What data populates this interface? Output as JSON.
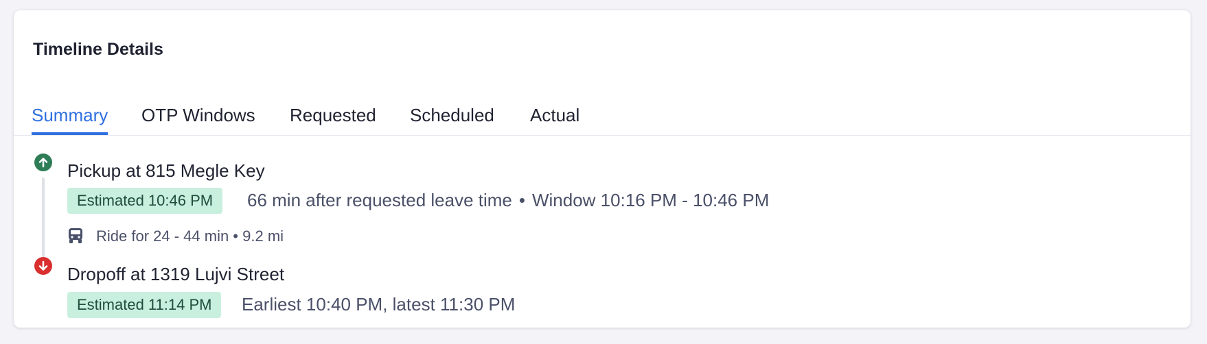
{
  "card": {
    "title": "Timeline Details"
  },
  "tabs": [
    {
      "label": "Summary",
      "active": true
    },
    {
      "label": "OTP Windows",
      "active": false
    },
    {
      "label": "Requested",
      "active": false
    },
    {
      "label": "Scheduled",
      "active": false
    },
    {
      "label": "Actual",
      "active": false
    }
  ],
  "pickup": {
    "title": "Pickup at 815 Megle Key",
    "badge": "Estimated 10:46 PM",
    "detail": "66 min after requested leave time",
    "separator": "•",
    "window": "Window 10:16 PM - 10:46 PM",
    "icon": "arrow-up-icon"
  },
  "ride": {
    "text": "Ride for 24 - 44 min • 9.2 mi",
    "icon": "bus-icon"
  },
  "dropoff": {
    "title": "Dropoff at 1319 Lujvi Street",
    "badge": "Estimated 11:14 PM",
    "detail": "Earliest 10:40 PM, latest 11:30 PM",
    "icon": "arrow-down-icon"
  },
  "colors": {
    "accent": "#2f6fe0",
    "pickup": "#2e7d57",
    "dropoff": "#d92f2f",
    "badge_bg": "#c9efde"
  }
}
